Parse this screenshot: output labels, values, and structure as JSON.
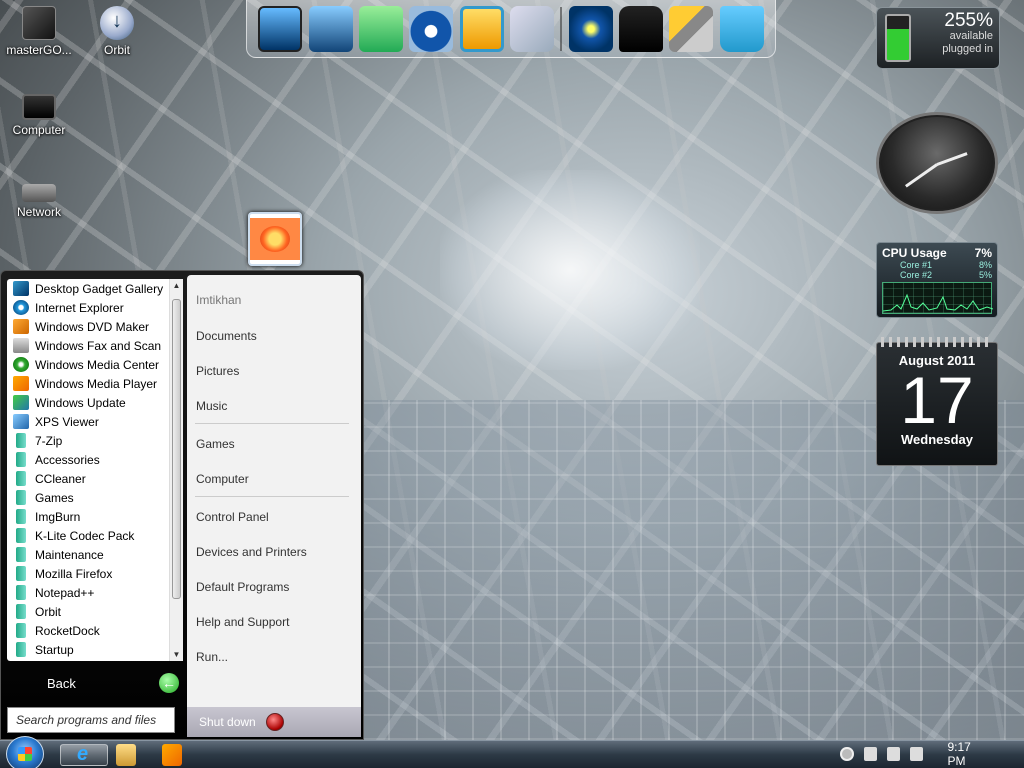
{
  "desktop": {
    "icons": [
      {
        "label": "masterGO...",
        "icon": "app-icon"
      },
      {
        "label": "Orbit",
        "icon": "download-icon"
      },
      {
        "label": "Computer",
        "icon": "computer-icon"
      },
      {
        "label": "Network",
        "icon": "network-icon"
      }
    ]
  },
  "dock": {
    "items": [
      "computer-monitor-icon",
      "network-computers-icon",
      "document-archive-icon",
      "media-player-icon",
      "pictures-folder-icon",
      "disc-icon",
      "media-center-icon",
      "tshirt-icon",
      "tools-icon",
      "recycle-bin-icon"
    ]
  },
  "gadgets": {
    "battery": {
      "percent": "255%",
      "status1": "available",
      "status2": "plugged in"
    },
    "cpu": {
      "title": "CPU Usage",
      "total": "7%",
      "cores": [
        {
          "label": "Core #1",
          "value": "8%"
        },
        {
          "label": "Core #2",
          "value": "5%"
        }
      ]
    },
    "calendar": {
      "month": "August 2011",
      "day": "17",
      "weekday": "Wednesday"
    }
  },
  "start_menu": {
    "programs": [
      {
        "label": "Desktop Gadget Gallery",
        "icon": "gadget-icon"
      },
      {
        "label": "Internet Explorer",
        "icon": "ie-icon"
      },
      {
        "label": "Windows DVD Maker",
        "icon": "dvd-icon"
      },
      {
        "label": "Windows Fax and Scan",
        "icon": "fax-icon"
      },
      {
        "label": "Windows Media Center",
        "icon": "media-center-icon"
      },
      {
        "label": "Windows Media Player",
        "icon": "media-player-icon"
      },
      {
        "label": "Windows Update",
        "icon": "update-icon"
      },
      {
        "label": "XPS Viewer",
        "icon": "xps-icon"
      },
      {
        "label": "7-Zip",
        "icon": "folder-icon"
      },
      {
        "label": "Accessories",
        "icon": "folder-icon"
      },
      {
        "label": "CCleaner",
        "icon": "folder-icon"
      },
      {
        "label": "Games",
        "icon": "folder-icon"
      },
      {
        "label": "ImgBurn",
        "icon": "folder-icon"
      },
      {
        "label": "K-Lite Codec Pack",
        "icon": "folder-icon"
      },
      {
        "label": "Maintenance",
        "icon": "folder-icon"
      },
      {
        "label": "Mozilla Firefox",
        "icon": "folder-icon"
      },
      {
        "label": "Notepad++",
        "icon": "folder-icon"
      },
      {
        "label": "Orbit",
        "icon": "folder-icon"
      },
      {
        "label": "RocketDock",
        "icon": "folder-icon"
      },
      {
        "label": "Startup",
        "icon": "folder-icon"
      }
    ],
    "back_label": "Back",
    "search_placeholder": "Search programs and files",
    "right": {
      "user": "Imtikhan",
      "documents": "Documents",
      "pictures": "Pictures",
      "music": "Music",
      "games": "Games",
      "computer": "Computer",
      "control_panel": "Control Panel",
      "devices": "Devices and Printers",
      "default_programs": "Default Programs",
      "help": "Help and Support",
      "run": "Run..."
    },
    "shutdown_label": "Shut down"
  },
  "taskbar": {
    "pinned": [
      "internet-explorer-icon",
      "folder-icon",
      "media-player-icon"
    ],
    "tray_icons": [
      "arrow-up-icon",
      "flag-icon",
      "network-icon",
      "volume-icon"
    ],
    "time": "9:17 PM"
  },
  "colors": {
    "taskbar": "#2d3a46",
    "start_menu_bg": "#000000",
    "right_pane_bg": "#f2f2f2",
    "shutdown_bg": "#b8b6c2"
  }
}
